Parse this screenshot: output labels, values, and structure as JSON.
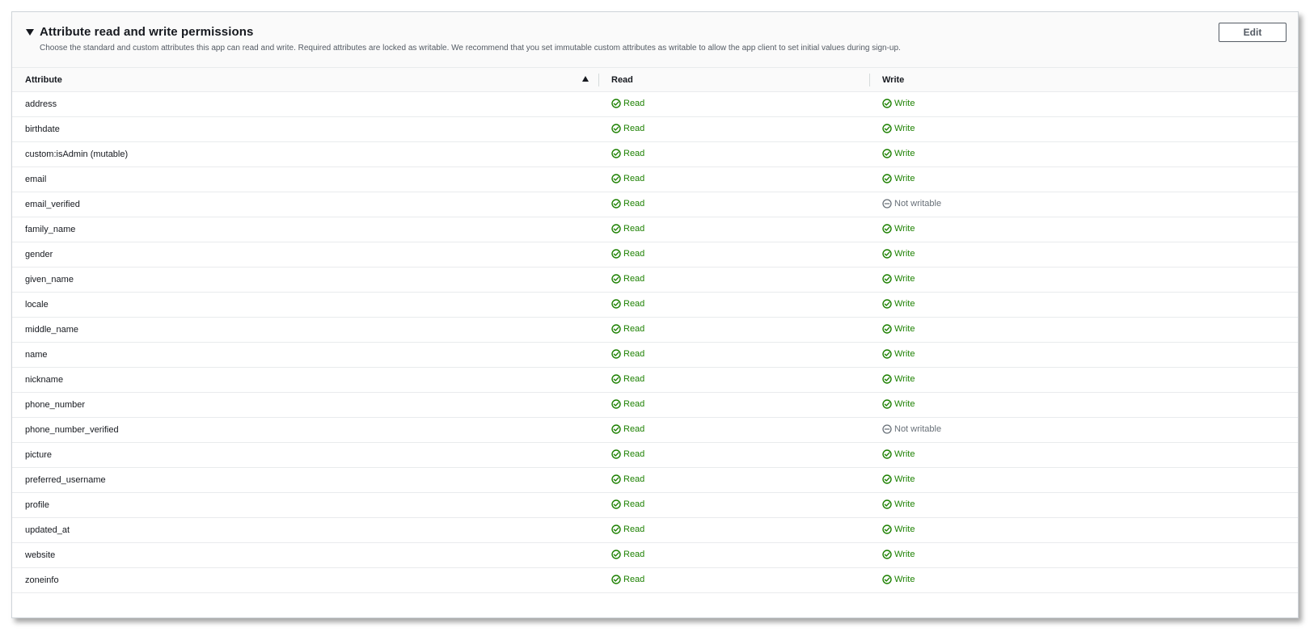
{
  "panel": {
    "title": "Attribute read and write permissions",
    "description": "Choose the standard and custom attributes this app can read and write. Required attributes are locked as writable. We recommend that you set immutable custom attributes as writable to allow the app client to set initial values during sign-up.",
    "edit_label": "Edit"
  },
  "table": {
    "columns": [
      "Attribute",
      "Read",
      "Write"
    ],
    "sort": "Attribute ascending",
    "rows": [
      {
        "attribute": "address",
        "read": "Read",
        "write": "Write"
      },
      {
        "attribute": "birthdate",
        "read": "Read",
        "write": "Write"
      },
      {
        "attribute": "custom:isAdmin (mutable)",
        "read": "Read",
        "write": "Write"
      },
      {
        "attribute": "email",
        "read": "Read",
        "write": "Write"
      },
      {
        "attribute": "email_verified",
        "read": "Read",
        "write": "Not writable"
      },
      {
        "attribute": "family_name",
        "read": "Read",
        "write": "Write"
      },
      {
        "attribute": "gender",
        "read": "Read",
        "write": "Write"
      },
      {
        "attribute": "given_name",
        "read": "Read",
        "write": "Write"
      },
      {
        "attribute": "locale",
        "read": "Read",
        "write": "Write"
      },
      {
        "attribute": "middle_name",
        "read": "Read",
        "write": "Write"
      },
      {
        "attribute": "name",
        "read": "Read",
        "write": "Write"
      },
      {
        "attribute": "nickname",
        "read": "Read",
        "write": "Write"
      },
      {
        "attribute": "phone_number",
        "read": "Read",
        "write": "Write"
      },
      {
        "attribute": "phone_number_verified",
        "read": "Read",
        "write": "Not writable"
      },
      {
        "attribute": "picture",
        "read": "Read",
        "write": "Write"
      },
      {
        "attribute": "preferred_username",
        "read": "Read",
        "write": "Write"
      },
      {
        "attribute": "profile",
        "read": "Read",
        "write": "Write"
      },
      {
        "attribute": "updated_at",
        "read": "Read",
        "write": "Write"
      },
      {
        "attribute": "website",
        "read": "Read",
        "write": "Write"
      },
      {
        "attribute": "zoneinfo",
        "read": "Read",
        "write": "Write"
      }
    ]
  },
  "colors": {
    "success": "#1d8102",
    "disabled": "#687078"
  },
  "icons": {
    "granted": "check-circle-icon",
    "denied": "minus-circle-icon"
  }
}
